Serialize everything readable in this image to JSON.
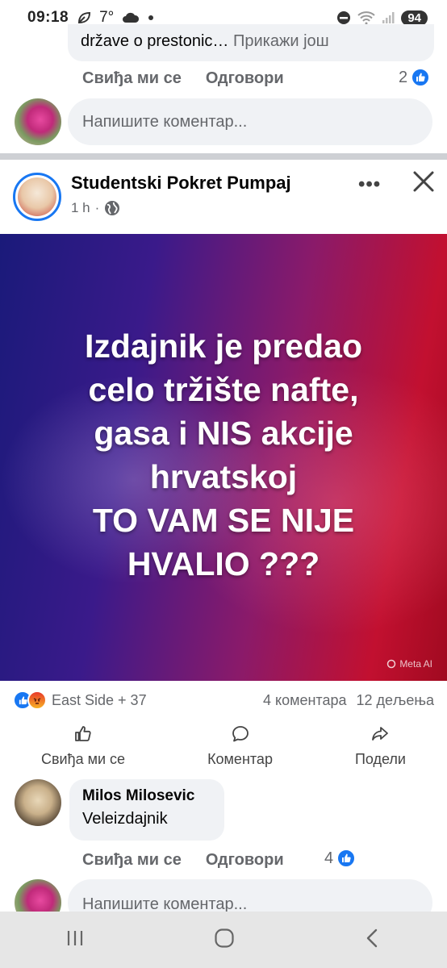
{
  "status_bar": {
    "time": "09:18",
    "temperature": "7°",
    "battery": "94"
  },
  "prev_comment": {
    "text": "države o prestonic…",
    "see_more": "Прикажи још",
    "like_label": "Свиђа ми се",
    "reply_label": "Одговори",
    "reaction_count": "2"
  },
  "comment_input_placeholder": "Напишите коментар...",
  "post": {
    "page_name": "Studentski Pokret Pumpaj",
    "time": "1 h",
    "image_text": "Izdajnik je predao\ncelo tržište nafte,\ngasa i NIS akcije\nhrvatskoj\nTO VAM SE NIJE\nHVALIO ???",
    "watermark": "Meta AI",
    "reactions_names": "East Side + 37",
    "comments_count": "4 коментара",
    "shares_count": "12 дељења",
    "actions": {
      "like": "Свиђа ми се",
      "comment": "Коментар",
      "share": "Подели"
    }
  },
  "comment": {
    "author": "Milos Milosevic",
    "text": "Veleizdajnik",
    "like_label": "Свиђа ми се",
    "reply_label": "Одговори",
    "reaction_count": "4"
  },
  "colors": {
    "facebook_blue": "#1877f2",
    "secondary_text": "#65676b",
    "bubble_bg": "#f0f2f5"
  }
}
